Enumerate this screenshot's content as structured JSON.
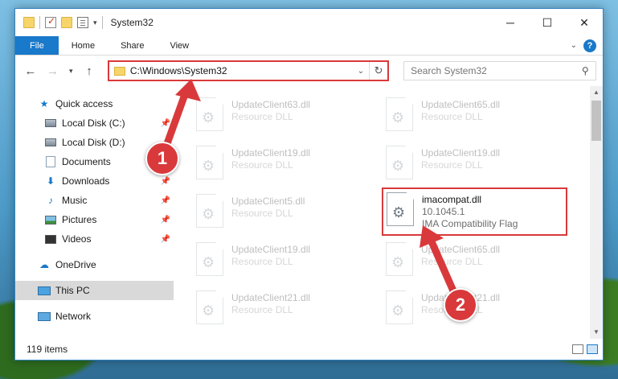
{
  "window": {
    "title": "System32",
    "controls": {
      "minimize": "─",
      "maximize": "☐",
      "close": "✕"
    }
  },
  "ribbon": {
    "tabs": [
      "File",
      "Home",
      "Share",
      "View"
    ]
  },
  "navigation": {
    "address": "C:\\Windows\\System32",
    "search_placeholder": "Search System32"
  },
  "sidebar": {
    "quick_access": "Quick access",
    "items": [
      {
        "label": "Local Disk (C:)",
        "icon": "drive-icon",
        "pinned": true
      },
      {
        "label": "Local Disk (D:)",
        "icon": "drive-icon",
        "pinned": false
      },
      {
        "label": "Documents",
        "icon": "documents-icon",
        "pinned": true
      },
      {
        "label": "Downloads",
        "icon": "downloads-icon",
        "pinned": true
      },
      {
        "label": "Music",
        "icon": "music-icon",
        "pinned": true
      },
      {
        "label": "Pictures",
        "icon": "pictures-icon",
        "pinned": true
      },
      {
        "label": "Videos",
        "icon": "videos-icon",
        "pinned": true
      }
    ],
    "onedrive": "OneDrive",
    "this_pc": "This PC",
    "network": "Network"
  },
  "files": [
    {
      "name": "UpdateClient63.dll",
      "type": "Resource DLL"
    },
    {
      "name": "UpdateClient65.dll",
      "type": "Resource DLL"
    },
    {
      "name": "UpdateClient19.dll",
      "type": "Resource DLL"
    },
    {
      "name": "UpdateClient19.dll",
      "type": "Resource DLL"
    },
    {
      "name": "UpdateClient5.dll",
      "type": "Resource DLL"
    },
    {
      "name": "UpdateClient19.dll",
      "type": "Resource DLL"
    },
    {
      "name": "UpdateClient65.dll",
      "type": "Resource DLL"
    },
    {
      "name": "UpdateClient21.dll",
      "type": "Resource DLL"
    },
    {
      "name": "UpdateClient21.dll",
      "type": "Resource DLL"
    }
  ],
  "highlighted_file": {
    "name": "imacompat.dll",
    "version": "10.1045.1",
    "description": "IMA Compatibility Flag"
  },
  "status": {
    "item_count": "119 items"
  },
  "callouts": {
    "one": "1",
    "two": "2"
  },
  "colors": {
    "accent": "#1979ca",
    "callout": "#d9393b"
  }
}
